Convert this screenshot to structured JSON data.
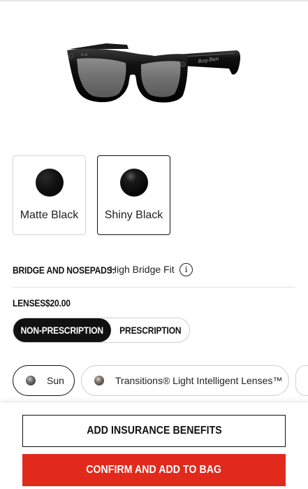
{
  "product": {
    "image_alt": "Ray-Ban Stories Wayfarer glasses, black frame with grey lenses",
    "brand_mark": "Ray-Ban"
  },
  "colors": {
    "options": [
      {
        "label": "Matte Black",
        "selected": false
      },
      {
        "label": "Shiny Black",
        "selected": true
      }
    ]
  },
  "bridge": {
    "title": "BRIDGE AND NOSEPADS:",
    "value": "High Bridge Fit",
    "info_icon": "i"
  },
  "lenses": {
    "title": "LENSES",
    "price": "$20.00",
    "toggle": {
      "options": [
        "NON-PRESCRIPTION",
        "PRESCRIPTION"
      ],
      "selected": "NON-PRESCRIPTION"
    },
    "types": [
      {
        "label": "Sun",
        "selected": true,
        "icon": "lens-swatch-icon"
      },
      {
        "label": "Transitions® Light Intelligent Lenses™",
        "selected": false,
        "icon": "lens-swatch-icon"
      }
    ]
  },
  "actions": {
    "insurance": "ADD INSURANCE BENEFITS",
    "confirm": "CONFIRM AND ADD TO BAG"
  },
  "theme": {
    "accent": "#e22a1c",
    "selected_fill": "#111111",
    "border": "#cfcfcf"
  }
}
